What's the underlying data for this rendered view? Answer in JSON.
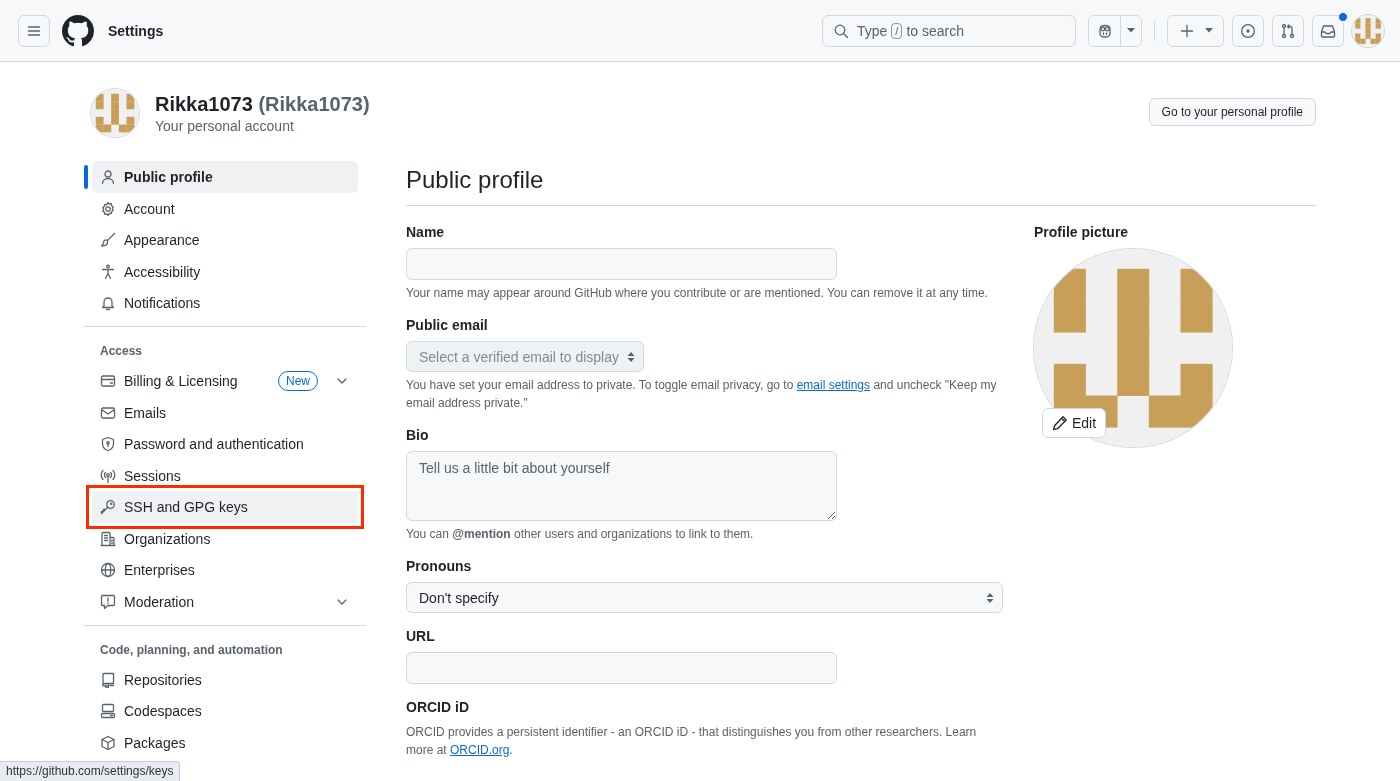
{
  "header": {
    "title": "Settings",
    "search": {
      "text_before": "Type",
      "shortcut_key": "/",
      "text_after": "to search"
    },
    "inbox_unread": true
  },
  "account": {
    "login": "Rikka1073",
    "name_paren": "(Rikka1073)",
    "subtitle": "Your personal account",
    "profile_button": "Go to your personal profile"
  },
  "sidebar": {
    "groups": [
      {
        "items": [
          {
            "label": "Public profile",
            "selected": true,
            "highlighted": false,
            "has_submenu": false
          },
          {
            "label": "Account",
            "selected": false,
            "highlighted": false,
            "has_submenu": false
          },
          {
            "label": "Appearance",
            "selected": false,
            "highlighted": false,
            "has_submenu": false
          },
          {
            "label": "Accessibility",
            "selected": false,
            "highlighted": false,
            "has_submenu": false
          },
          {
            "label": "Notifications",
            "selected": false,
            "highlighted": false,
            "has_submenu": false
          }
        ]
      },
      {
        "heading": "Access",
        "items": [
          {
            "label": "Billing & Licensing",
            "badge": "New",
            "selected": false,
            "highlighted": false,
            "has_submenu": true
          },
          {
            "label": "Emails",
            "selected": false,
            "highlighted": false,
            "has_submenu": false
          },
          {
            "label": "Password and authentication",
            "selected": false,
            "highlighted": false,
            "has_submenu": false
          },
          {
            "label": "Sessions",
            "selected": false,
            "highlighted": false,
            "has_submenu": false
          },
          {
            "label": "SSH and GPG keys",
            "selected": false,
            "highlighted": true,
            "has_submenu": false
          },
          {
            "label": "Organizations",
            "selected": false,
            "highlighted": false,
            "has_submenu": false
          },
          {
            "label": "Enterprises",
            "selected": false,
            "highlighted": false,
            "has_submenu": false
          },
          {
            "label": "Moderation",
            "selected": false,
            "highlighted": false,
            "has_submenu": true
          }
        ]
      },
      {
        "heading": "Code, planning, and automation",
        "items": [
          {
            "label": "Repositories",
            "selected": false,
            "highlighted": false,
            "has_submenu": false
          },
          {
            "label": "Codespaces",
            "selected": false,
            "highlighted": false,
            "has_submenu": false
          },
          {
            "label": "Packages",
            "selected": false,
            "highlighted": false,
            "has_submenu": false
          }
        ]
      }
    ]
  },
  "main": {
    "title": "Public profile",
    "fields": [
      {
        "kind": "text",
        "label": "Name",
        "note": "Your name may appear around GitHub where you contribute or are mentioned. You can remove it at any time."
      },
      {
        "kind": "select",
        "label": "Public email",
        "value": "Select a verified email to display",
        "disabled": true,
        "note": "You have set your email address to private. To toggle email privacy, go to",
        "note_link": "email settings",
        "note_after": "and uncheck \"Keep my email address private.\""
      },
      {
        "kind": "textarea",
        "label": "Bio",
        "placeholder": "Tell us a little bit about yourself",
        "note": "You can **@mention** other users and organizations to link to them."
      },
      {
        "kind": "select",
        "label": "Pronouns",
        "value": "Don't specify",
        "disabled": false
      },
      {
        "kind": "text",
        "label": "URL"
      },
      {
        "kind": "info",
        "label": "ORCID iD",
        "note": "ORCID provides a persistent identifier - an ORCID iD - that distinguishes you from other researchers. Learn more at",
        "note_link": "ORCID.org",
        "note_after": "."
      }
    ],
    "profile_picture": {
      "label": "Profile picture",
      "edit_button": "Edit"
    }
  },
  "status_url": "https://github.com/settings/keys"
}
